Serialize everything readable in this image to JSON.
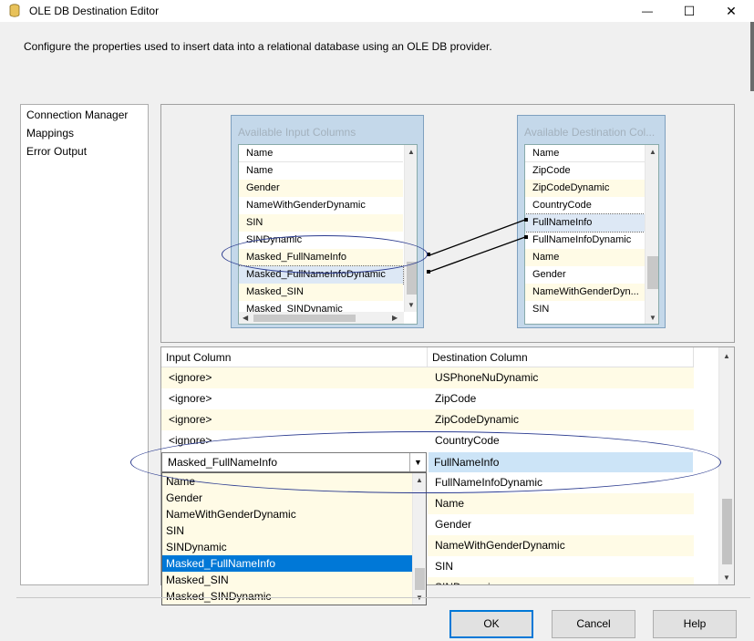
{
  "window": {
    "title": "OLE DB Destination Editor",
    "controls": {
      "minimize": "—",
      "maximize": "☐",
      "close": "✕"
    }
  },
  "description": "Configure the properties used to insert data into a relational database using an OLE DB provider.",
  "nav": {
    "items": [
      "Connection Manager",
      "Mappings",
      "Error Output"
    ]
  },
  "available_input": {
    "title": "Available Input Columns",
    "header": "Name",
    "rows": [
      "Name",
      "Gender",
      "NameWithGenderDynamic",
      "SIN",
      "SINDynamic",
      "Masked_FullNameInfo",
      "Masked_FullNameInfoDynamic",
      "Masked_SIN",
      "Masked_SINDynamic"
    ]
  },
  "available_destination": {
    "title": "Available Destination Col...",
    "header": "Name",
    "rows": [
      "ZipCode",
      "ZipCodeDynamic",
      "CountryCode",
      "FullNameInfo",
      "FullNameInfoDynamic",
      "Name",
      "Gender",
      "NameWithGenderDyn...",
      "SIN"
    ]
  },
  "grid": {
    "headers": [
      "Input Column",
      "Destination Column"
    ],
    "rows": [
      {
        "input": "<ignore>",
        "destination": "USPhoneNuDynamic"
      },
      {
        "input": "<ignore>",
        "destination": "ZipCode"
      },
      {
        "input": "<ignore>",
        "destination": "ZipCodeDynamic"
      },
      {
        "input": "<ignore>",
        "destination": "CountryCode"
      },
      {
        "input": "Masked_FullNameInfo",
        "destination": "FullNameInfo"
      },
      {
        "input": "",
        "destination": "FullNameInfoDynamic"
      },
      {
        "input": "",
        "destination": "Name"
      },
      {
        "input": "",
        "destination": "Gender"
      },
      {
        "input": "",
        "destination": "NameWithGenderDynamic"
      },
      {
        "input": "",
        "destination": "SIN"
      },
      {
        "input": "",
        "destination": "SINDynamic"
      }
    ]
  },
  "dropdown": {
    "selected": "Masked_FullNameInfo",
    "options": [
      "Name",
      "Gender",
      "NameWithGenderDynamic",
      "SIN",
      "SINDynamic",
      "Masked_FullNameInfo",
      "Masked_SIN",
      "Masked_SINDynamic"
    ]
  },
  "buttons": {
    "ok": "OK",
    "cancel": "Cancel",
    "help": "Help"
  }
}
